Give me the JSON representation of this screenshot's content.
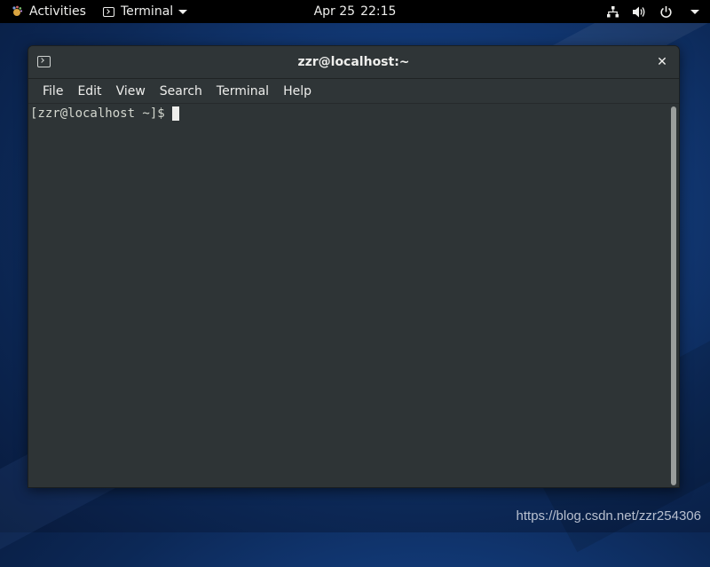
{
  "topbar": {
    "activities_label": "Activities",
    "app_menu_label": "Terminal",
    "clock": {
      "date": "Apr 25",
      "time": "22:15"
    },
    "tray_icons": [
      "network-icon",
      "volume-icon",
      "power-icon"
    ]
  },
  "window": {
    "title": "zzr@localhost:~",
    "menu": [
      "File",
      "Edit",
      "View",
      "Search",
      "Terminal",
      "Help"
    ],
    "prompt": "[zzr@localhost ~]$ "
  },
  "watermark": "https://blog.csdn.net/zzr254306",
  "colors": {
    "terminal_bg": "#2e3436",
    "topbar_bg": "#000000",
    "text": "#eeeeec",
    "wallpaper": "#123a78"
  }
}
